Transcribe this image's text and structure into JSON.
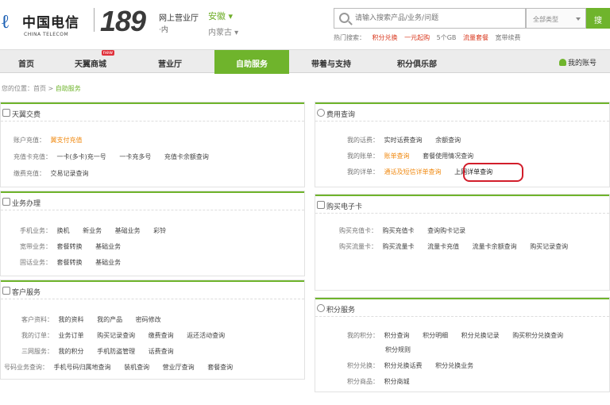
{
  "header": {
    "logo_cn": "中国电信",
    "logo_en": "CHINA TELECOM",
    "brand": "189",
    "brand_sub1": "网上营业厅",
    "brand_sub2": "·内",
    "region": "安徽",
    "region_sub": "内蒙古",
    "search_placeholder": "请输入搜索产品/业务/问题",
    "search_scope": "全部类型",
    "search_button": "搜",
    "hot_links": [
      {
        "text": "热门搜索：",
        "style": "gray"
      },
      {
        "text": "积分兑换",
        "style": "red"
      },
      {
        "text": "一元起购",
        "style": "red"
      },
      {
        "text": "5个GB",
        "style": "gray"
      },
      {
        "text": "流量套餐",
        "style": "red"
      },
      {
        "text": "宽带续费",
        "style": "gray"
      }
    ]
  },
  "nav": {
    "items": [
      "首页",
      "天翼商城",
      "营业厅",
      "自助服务",
      "带着与支持",
      "积分俱乐部"
    ],
    "active_index": 3,
    "new_badge": "new",
    "my_account": "我的账号"
  },
  "breadcrumb": {
    "prefix": "您的位置：首页 >",
    "current": "自助服务"
  },
  "panels": {
    "tianyi": {
      "title": "天翼交费",
      "rows": [
        {
          "label": "账户充值：",
          "links": [
            {
              "text": "翼支付充值",
              "orange": true
            }
          ]
        },
        {
          "label": "充值卡充值：",
          "links": [
            {
              "text": "一卡(多卡)充一号"
            },
            {
              "text": "一卡充多号"
            },
            {
              "text": "充值卡余额查询"
            }
          ]
        },
        {
          "label": "缴费充值：",
          "links": [
            {
              "text": "交易记录查询"
            }
          ]
        }
      ]
    },
    "business": {
      "title": "业务办理",
      "rows": [
        {
          "label": "手机业务：",
          "links": [
            {
              "text": "换机"
            },
            {
              "text": "新业务"
            },
            {
              "text": "基础业务"
            },
            {
              "text": "彩铃"
            }
          ]
        },
        {
          "label": "宽带业务：",
          "links": [
            {
              "text": "套餐转换"
            },
            {
              "text": "基础业务"
            }
          ]
        },
        {
          "label": "固话业务：",
          "links": [
            {
              "text": "套餐转换"
            },
            {
              "text": "基础业务"
            }
          ]
        }
      ]
    },
    "customer": {
      "title": "客户服务",
      "rows": [
        {
          "label": "客户资料：",
          "links": [
            {
              "text": "我的资料"
            },
            {
              "text": "我的产品"
            },
            {
              "text": "密码修改"
            }
          ]
        },
        {
          "label": "我的订单：",
          "links": [
            {
              "text": "业务订单"
            },
            {
              "text": "购买记录查询"
            },
            {
              "text": "缴费查询"
            },
            {
              "text": "返还活动查询"
            }
          ]
        },
        {
          "label": "三网服务：",
          "links": [
            {
              "text": "我的积分"
            },
            {
              "text": "手机防盗管理"
            },
            {
              "text": "话费查询"
            }
          ]
        },
        {
          "label": "号码业务查询：",
          "links": [
            {
              "text": "手机号码归属地查询"
            },
            {
              "text": "装机查询"
            },
            {
              "text": "营业厅查询"
            },
            {
              "text": "套餐查询"
            }
          ]
        }
      ]
    },
    "query": {
      "title": "费用查询",
      "rows": [
        {
          "label": "我的话费：",
          "links": [
            {
              "text": "实时话费查询"
            },
            {
              "text": "余额查询"
            }
          ]
        },
        {
          "label": "我的账单：",
          "links": [
            {
              "text": "账单查询",
              "orange": true
            },
            {
              "text": "套餐使用情况查询"
            }
          ]
        },
        {
          "label": "我的详单：",
          "links": [
            {
              "text": "通话及短信详单查询",
              "orange": true
            },
            {
              "text": "上网详单查询",
              "circled": true
            }
          ]
        }
      ]
    },
    "purchase": {
      "title": "购买电子卡",
      "rows": [
        {
          "label": "购买充值卡：",
          "links": [
            {
              "text": "购买充值卡"
            },
            {
              "text": "查询购卡记录"
            }
          ]
        },
        {
          "label": "购买流量卡：",
          "links": [
            {
              "text": "购买流量卡"
            },
            {
              "text": "流量卡充值"
            },
            {
              "text": "流量卡余额查询"
            },
            {
              "text": "购买记录查询"
            }
          ]
        }
      ]
    },
    "points": {
      "title": "积分服务",
      "rows": [
        {
          "label": "我的积分：",
          "links": [
            {
              "text": "积分查询"
            },
            {
              "text": "积分明细"
            },
            {
              "text": "积分兑换记录"
            },
            {
              "text": "购买积分兑换查询"
            }
          ]
        },
        {
          "label": "",
          "links": [
            {
              "text": "积分规则"
            }
          ]
        },
        {
          "label": "积分兑换：",
          "links": [
            {
              "text": "积分兑换话费"
            },
            {
              "text": "积分兑换业务"
            }
          ]
        },
        {
          "label": "积分商品：",
          "links": [
            {
              "text": "积分商城"
            }
          ]
        }
      ]
    }
  }
}
